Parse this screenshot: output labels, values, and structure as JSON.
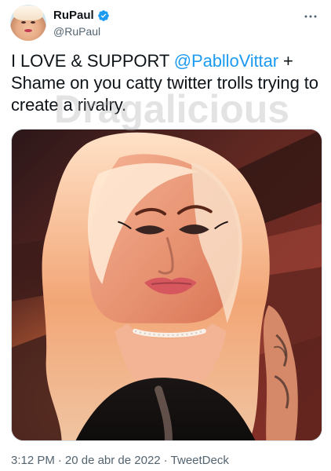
{
  "user": {
    "display_name": "RuPaul",
    "handle": "@RuPaul",
    "verified": true
  },
  "tweet": {
    "text_intro": "I LOVE & SUPPORT ",
    "mention": "@PablloVittar",
    "text_rest": " + Shame on you catty twitter trolls trying to create a rivalry."
  },
  "watermark": {
    "text": "Dragalicious"
  },
  "meta": {
    "time": "3:12 PM",
    "separator": "·",
    "date": "20 de abr de 2022",
    "source": "TweetDeck"
  },
  "icons": {
    "verified_badge": "verified-badge-icon",
    "more": "more-options-icon"
  },
  "colors": {
    "accent": "#1d9bf0",
    "text_primary": "#0f1419",
    "text_secondary": "#536471"
  }
}
